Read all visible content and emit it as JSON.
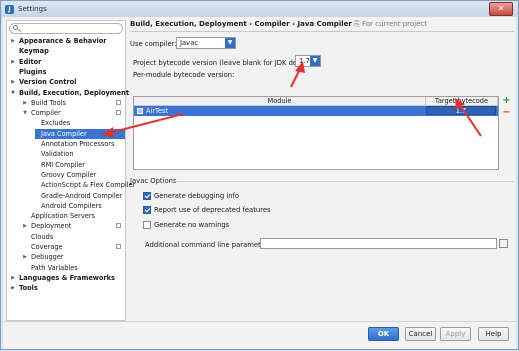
{
  "window": {
    "title": "Settings",
    "close_label": "✕"
  },
  "search": {
    "placeholder": ""
  },
  "tree": [
    {
      "label": "Appearance & Behavior",
      "bold": true,
      "arrow": "▶",
      "indent": 0
    },
    {
      "label": "Keymap",
      "bold": true,
      "arrow": "",
      "indent": 0
    },
    {
      "label": "Editor",
      "bold": true,
      "arrow": "▶",
      "indent": 0
    },
    {
      "label": "Plugins",
      "bold": true,
      "arrow": "",
      "indent": 0
    },
    {
      "label": "Version Control",
      "bold": true,
      "arrow": "▶",
      "indent": 0
    },
    {
      "label": "Build, Execution, Deployment",
      "bold": true,
      "arrow": "▼",
      "indent": 0
    },
    {
      "label": "Build Tools",
      "bold": false,
      "arrow": "▶",
      "indent": 1,
      "cfg": true
    },
    {
      "label": "Compiler",
      "bold": false,
      "arrow": "▼",
      "indent": 1,
      "cfg": true
    },
    {
      "label": "Excludes",
      "bold": false,
      "arrow": "",
      "indent": 2
    },
    {
      "label": "Java Compiler",
      "bold": false,
      "arrow": "",
      "indent": 2,
      "selected": true
    },
    {
      "label": "Annotation Processors",
      "bold": false,
      "arrow": "",
      "indent": 2
    },
    {
      "label": "Validation",
      "bold": false,
      "arrow": "",
      "indent": 2
    },
    {
      "label": "RMI Compiler",
      "bold": false,
      "arrow": "",
      "indent": 2
    },
    {
      "label": "Groovy Compiler",
      "bold": false,
      "arrow": "",
      "indent": 2
    },
    {
      "label": "ActionScript & Flex Compiler",
      "bold": false,
      "arrow": "",
      "indent": 2
    },
    {
      "label": "Gradle-Android Compiler",
      "bold": false,
      "arrow": "",
      "indent": 2
    },
    {
      "label": "Android Compilers",
      "bold": false,
      "arrow": "",
      "indent": 2
    },
    {
      "label": "Application Servers",
      "bold": false,
      "arrow": "",
      "indent": 1
    },
    {
      "label": "Deployment",
      "bold": false,
      "arrow": "▶",
      "indent": 1,
      "cfg": true
    },
    {
      "label": "Clouds",
      "bold": false,
      "arrow": "",
      "indent": 1
    },
    {
      "label": "Coverage",
      "bold": false,
      "arrow": "",
      "indent": 1,
      "cfg": true
    },
    {
      "label": "Debugger",
      "bold": false,
      "arrow": "▶",
      "indent": 1
    },
    {
      "label": "Path Variables",
      "bold": false,
      "arrow": "",
      "indent": 1
    },
    {
      "label": "Languages & Frameworks",
      "bold": true,
      "arrow": "▶",
      "indent": 0
    },
    {
      "label": "Tools",
      "bold": true,
      "arrow": "▶",
      "indent": 0
    }
  ],
  "breadcrumb": {
    "path": "Build, Execution, Deployment › Compiler › Java Compiler",
    "note": "⎘ For current project"
  },
  "compiler": {
    "label": "Use compiler:",
    "value": "Javac"
  },
  "bytecode": {
    "label": "Project bytecode version (leave blank for JDK default):",
    "value": "1.7"
  },
  "per_module": {
    "label": "Per-module bytecode version:"
  },
  "table": {
    "headers": [
      "Module",
      "Target bytecode version"
    ],
    "rows": [
      {
        "module": "AirTest",
        "version": "1.7"
      }
    ],
    "add_label": "+",
    "remove_label": "−"
  },
  "javac_options": {
    "title": "Javac Options",
    "checkboxes": [
      {
        "label": "Generate debugging info",
        "checked": true
      },
      {
        "label": "Report use of deprecated features",
        "checked": true
      },
      {
        "label": "Generate no warnings",
        "checked": false
      }
    ],
    "params_label": "Additional command line parameters:",
    "params_value": ""
  },
  "footer": {
    "ok": "OK",
    "cancel": "Cancel",
    "apply": "Apply",
    "help": "Help"
  },
  "colors": {
    "selection": "#3875d7",
    "accent": "#2e6fc7",
    "annotation": "#e8312a"
  }
}
